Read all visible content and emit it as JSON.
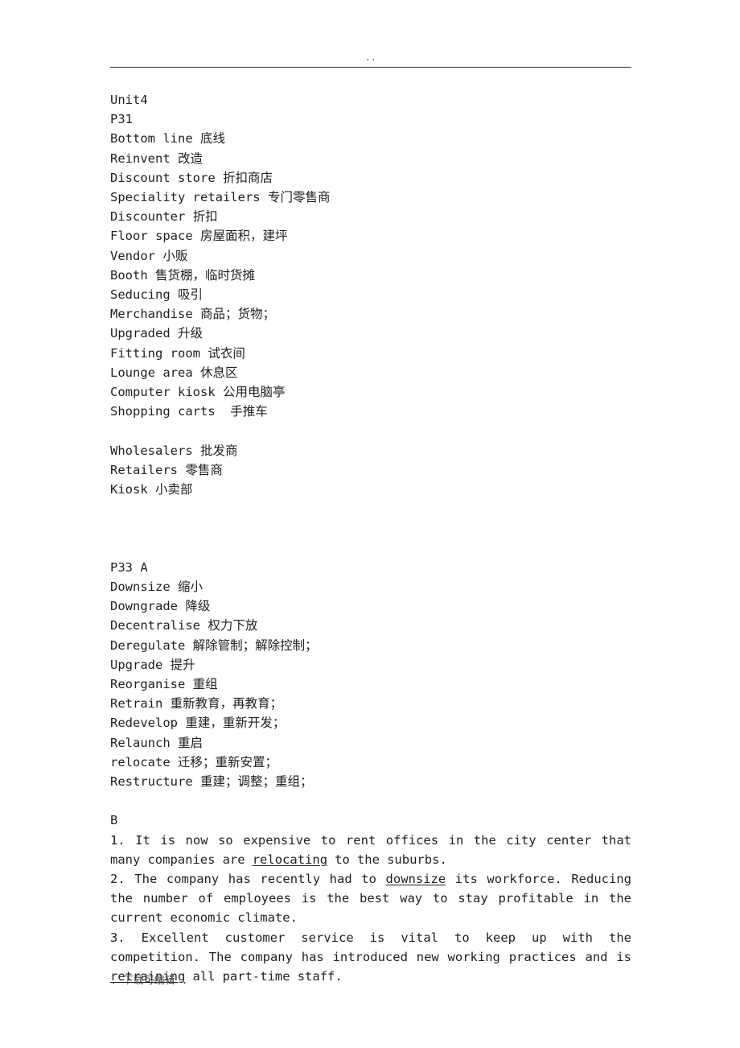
{
  "document": {
    "header": {
      "mark": "..",
      "rule": true
    },
    "footer": {
      "text": ". 下载可编辑 ."
    },
    "body": {
      "unit_heading": "Unit4",
      "page_ref_1": "P31",
      "vocab_p31": [
        "Bottom line 底线",
        "Reinvent 改造",
        "Discount store 折扣商店",
        "Speciality retailers 专门零售商",
        "Discounter 折扣",
        "Floor space 房屋面积，建坪",
        "Vendor 小贩",
        "Booth 售货棚，临时货摊",
        "Seducing 吸引",
        "Merchandise 商品；货物；",
        "Upgraded 升级",
        "Fitting room 试衣间",
        "Lounge area 休息区",
        "Computer kiosk 公用电脑亭",
        "Shopping carts  手推车"
      ],
      "vocab_sellers": [
        "Wholesalers 批发商",
        "Retailers 零售商",
        "Kiosk 小卖部"
      ],
      "page_ref_2": "P33 A",
      "vocab_p33a": [
        "Downsize 缩小",
        "Downgrade 降级",
        "Decentralise 权力下放",
        "Deregulate 解除管制；解除控制；",
        "Upgrade 提升",
        "Reorganise 重组",
        "Retrain 重新教育，再教育；",
        "Redevelop 重建，重新开发；",
        "Relaunch 重启",
        "relocate 迁移；重新安置；",
        "Restructure 重建；调整；重组；"
      ],
      "section_b_label": "B",
      "section_b_items": [
        {
          "number": "1.",
          "parts": [
            {
              "text": " It is now so expensive to rent offices in the city center that many companies are ",
              "underline": false
            },
            {
              "text": "relocating",
              "underline": true
            },
            {
              "text": " to the suburbs.",
              "underline": false
            }
          ]
        },
        {
          "number": "2.",
          "parts": [
            {
              "text": " The company has recently had to ",
              "underline": false
            },
            {
              "text": "downsize",
              "underline": true
            },
            {
              "text": " its workforce. Reducing the number of employees is the best way to stay profitable in the current economic climate.",
              "underline": false
            }
          ]
        },
        {
          "number": "3.",
          "parts": [
            {
              "text": " Excellent customer service is vital to keep up with the competition. The company has introduced new working practices and is ",
              "underline": false
            },
            {
              "text": "retraining",
              "underline": true
            },
            {
              "text": " all part-time staff.",
              "underline": false
            }
          ]
        }
      ]
    }
  }
}
